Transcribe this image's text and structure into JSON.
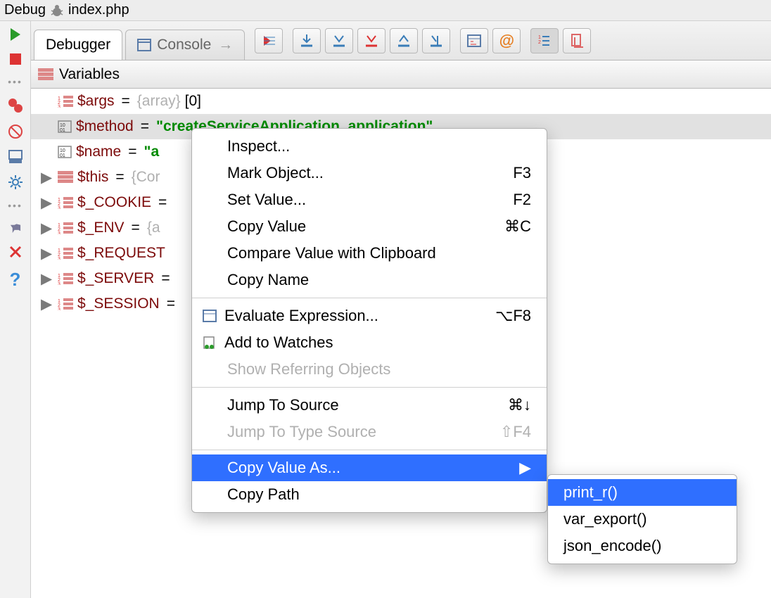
{
  "titlebar": {
    "title": "Debug",
    "file": "index.php"
  },
  "tabs": {
    "debugger": "Debugger",
    "console": "Console"
  },
  "panel": {
    "title": "Variables"
  },
  "vars": [
    {
      "name": "$args",
      "eq": "=",
      "type_prefix": "{array}",
      "suffix": "[0]",
      "icon": "array",
      "expandable": false
    },
    {
      "name": "$method",
      "eq": "=",
      "str": "\"createServiceApplication_application\"",
      "icon": "binary",
      "expandable": false,
      "selected": true
    },
    {
      "name": "$name",
      "eq": "=",
      "str": "\"a",
      "icon": "binary",
      "expandable": false
    },
    {
      "name": "$this",
      "eq": "=",
      "type_prefix": "{Cor",
      "icon": "bars",
      "expandable": true
    },
    {
      "name": "$_COOKIE",
      "eq": "=",
      "icon": "array",
      "expandable": true
    },
    {
      "name": "$_ENV",
      "eq": "=",
      "type_prefix": "{a",
      "icon": "array",
      "expandable": true
    },
    {
      "name": "$_REQUEST",
      "eq": "",
      "icon": "array",
      "expandable": true
    },
    {
      "name": "$_SERVER",
      "eq": "=",
      "icon": "array",
      "expandable": true
    },
    {
      "name": "$_SESSION",
      "eq": "=",
      "icon": "array",
      "expandable": true
    }
  ],
  "context_menu": {
    "items": [
      {
        "label": "Inspect...",
        "shortcut": ""
      },
      {
        "label": "Mark Object...",
        "shortcut": "F3"
      },
      {
        "label": "Set Value...",
        "shortcut": "F2"
      },
      {
        "label": "Copy Value",
        "shortcut": "⌘C"
      },
      {
        "label": "Compare Value with Clipboard",
        "shortcut": ""
      },
      {
        "label": "Copy Name",
        "shortcut": ""
      },
      {
        "sep": true
      },
      {
        "label": "Evaluate Expression...",
        "shortcut": "⌥F8",
        "icon": "calc"
      },
      {
        "label": "Add to Watches",
        "shortcut": "",
        "icon": "watch"
      },
      {
        "label": "Show Referring Objects",
        "shortcut": "",
        "disabled": true
      },
      {
        "sep": true
      },
      {
        "label": "Jump To Source",
        "shortcut": "⌘↓"
      },
      {
        "label": "Jump To Type Source",
        "shortcut": "⇧F4",
        "disabled": true
      },
      {
        "sep": true
      },
      {
        "label": "Copy Value As...",
        "shortcut": "",
        "submenu": true,
        "highlight": true
      },
      {
        "label": "Copy Path",
        "shortcut": ""
      }
    ]
  },
  "submenu": {
    "items": [
      {
        "label": "print_r()",
        "highlight": true
      },
      {
        "label": "var_export()"
      },
      {
        "label": "json_encode()"
      }
    ]
  }
}
